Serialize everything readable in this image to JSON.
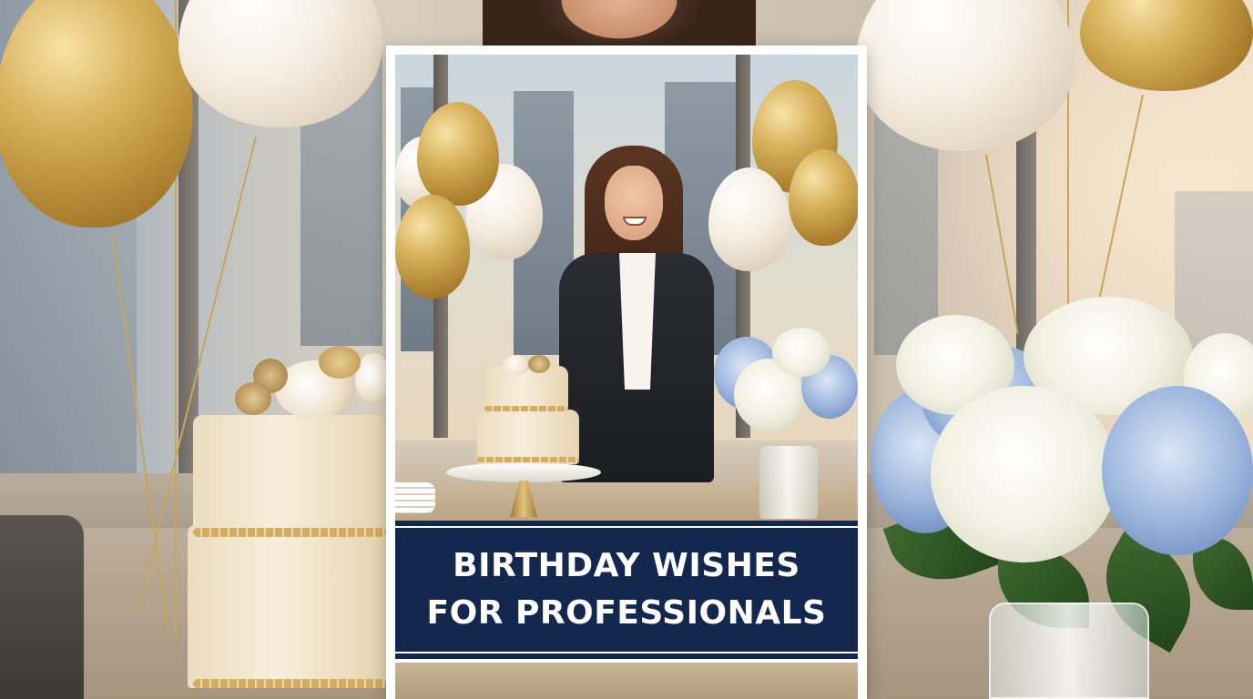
{
  "graphic": {
    "title_line1": "BIRTHDAY WISHES",
    "title_line2": "FOR PROFESSIONALS"
  },
  "colors": {
    "banner_background": "#14284f",
    "banner_text": "#ffffff",
    "card_border": "#ffffff",
    "balloon_gold": "#d8b25c",
    "balloon_white": "#f5ede0",
    "hydrangea_blue": "#9fb8de",
    "hydrangea_white": "#f2f1e3"
  }
}
